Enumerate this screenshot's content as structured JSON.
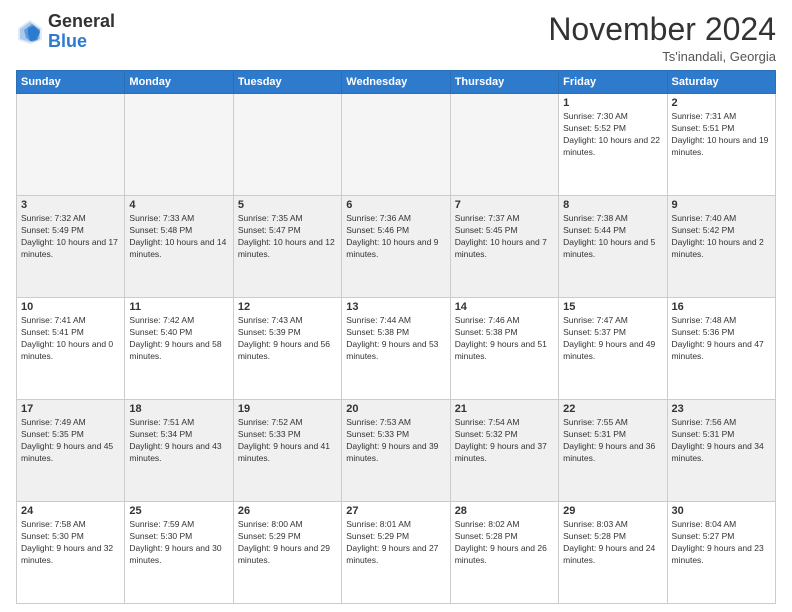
{
  "logo": {
    "general": "General",
    "blue": "Blue"
  },
  "header": {
    "month_year": "November 2024",
    "location": "Ts'inandali, Georgia"
  },
  "weekdays": [
    "Sunday",
    "Monday",
    "Tuesday",
    "Wednesday",
    "Thursday",
    "Friday",
    "Saturday"
  ],
  "weeks": [
    [
      {
        "day": "",
        "empty": true
      },
      {
        "day": "",
        "empty": true
      },
      {
        "day": "",
        "empty": true
      },
      {
        "day": "",
        "empty": true
      },
      {
        "day": "",
        "empty": true
      },
      {
        "day": "1",
        "sunrise": "7:30 AM",
        "sunset": "5:52 PM",
        "daylight": "10 hours and 22 minutes."
      },
      {
        "day": "2",
        "sunrise": "7:31 AM",
        "sunset": "5:51 PM",
        "daylight": "10 hours and 19 minutes."
      }
    ],
    [
      {
        "day": "3",
        "sunrise": "7:32 AM",
        "sunset": "5:49 PM",
        "daylight": "10 hours and 17 minutes."
      },
      {
        "day": "4",
        "sunrise": "7:33 AM",
        "sunset": "5:48 PM",
        "daylight": "10 hours and 14 minutes."
      },
      {
        "day": "5",
        "sunrise": "7:35 AM",
        "sunset": "5:47 PM",
        "daylight": "10 hours and 12 minutes."
      },
      {
        "day": "6",
        "sunrise": "7:36 AM",
        "sunset": "5:46 PM",
        "daylight": "10 hours and 9 minutes."
      },
      {
        "day": "7",
        "sunrise": "7:37 AM",
        "sunset": "5:45 PM",
        "daylight": "10 hours and 7 minutes."
      },
      {
        "day": "8",
        "sunrise": "7:38 AM",
        "sunset": "5:44 PM",
        "daylight": "10 hours and 5 minutes."
      },
      {
        "day": "9",
        "sunrise": "7:40 AM",
        "sunset": "5:42 PM",
        "daylight": "10 hours and 2 minutes."
      }
    ],
    [
      {
        "day": "10",
        "sunrise": "7:41 AM",
        "sunset": "5:41 PM",
        "daylight": "10 hours and 0 minutes."
      },
      {
        "day": "11",
        "sunrise": "7:42 AM",
        "sunset": "5:40 PM",
        "daylight": "9 hours and 58 minutes."
      },
      {
        "day": "12",
        "sunrise": "7:43 AM",
        "sunset": "5:39 PM",
        "daylight": "9 hours and 56 minutes."
      },
      {
        "day": "13",
        "sunrise": "7:44 AM",
        "sunset": "5:38 PM",
        "daylight": "9 hours and 53 minutes."
      },
      {
        "day": "14",
        "sunrise": "7:46 AM",
        "sunset": "5:38 PM",
        "daylight": "9 hours and 51 minutes."
      },
      {
        "day": "15",
        "sunrise": "7:47 AM",
        "sunset": "5:37 PM",
        "daylight": "9 hours and 49 minutes."
      },
      {
        "day": "16",
        "sunrise": "7:48 AM",
        "sunset": "5:36 PM",
        "daylight": "9 hours and 47 minutes."
      }
    ],
    [
      {
        "day": "17",
        "sunrise": "7:49 AM",
        "sunset": "5:35 PM",
        "daylight": "9 hours and 45 minutes."
      },
      {
        "day": "18",
        "sunrise": "7:51 AM",
        "sunset": "5:34 PM",
        "daylight": "9 hours and 43 minutes."
      },
      {
        "day": "19",
        "sunrise": "7:52 AM",
        "sunset": "5:33 PM",
        "daylight": "9 hours and 41 minutes."
      },
      {
        "day": "20",
        "sunrise": "7:53 AM",
        "sunset": "5:33 PM",
        "daylight": "9 hours and 39 minutes."
      },
      {
        "day": "21",
        "sunrise": "7:54 AM",
        "sunset": "5:32 PM",
        "daylight": "9 hours and 37 minutes."
      },
      {
        "day": "22",
        "sunrise": "7:55 AM",
        "sunset": "5:31 PM",
        "daylight": "9 hours and 36 minutes."
      },
      {
        "day": "23",
        "sunrise": "7:56 AM",
        "sunset": "5:31 PM",
        "daylight": "9 hours and 34 minutes."
      }
    ],
    [
      {
        "day": "24",
        "sunrise": "7:58 AM",
        "sunset": "5:30 PM",
        "daylight": "9 hours and 32 minutes."
      },
      {
        "day": "25",
        "sunrise": "7:59 AM",
        "sunset": "5:30 PM",
        "daylight": "9 hours and 30 minutes."
      },
      {
        "day": "26",
        "sunrise": "8:00 AM",
        "sunset": "5:29 PM",
        "daylight": "9 hours and 29 minutes."
      },
      {
        "day": "27",
        "sunrise": "8:01 AM",
        "sunset": "5:29 PM",
        "daylight": "9 hours and 27 minutes."
      },
      {
        "day": "28",
        "sunrise": "8:02 AM",
        "sunset": "5:28 PM",
        "daylight": "9 hours and 26 minutes."
      },
      {
        "day": "29",
        "sunrise": "8:03 AM",
        "sunset": "5:28 PM",
        "daylight": "9 hours and 24 minutes."
      },
      {
        "day": "30",
        "sunrise": "8:04 AM",
        "sunset": "5:27 PM",
        "daylight": "9 hours and 23 minutes."
      }
    ]
  ]
}
